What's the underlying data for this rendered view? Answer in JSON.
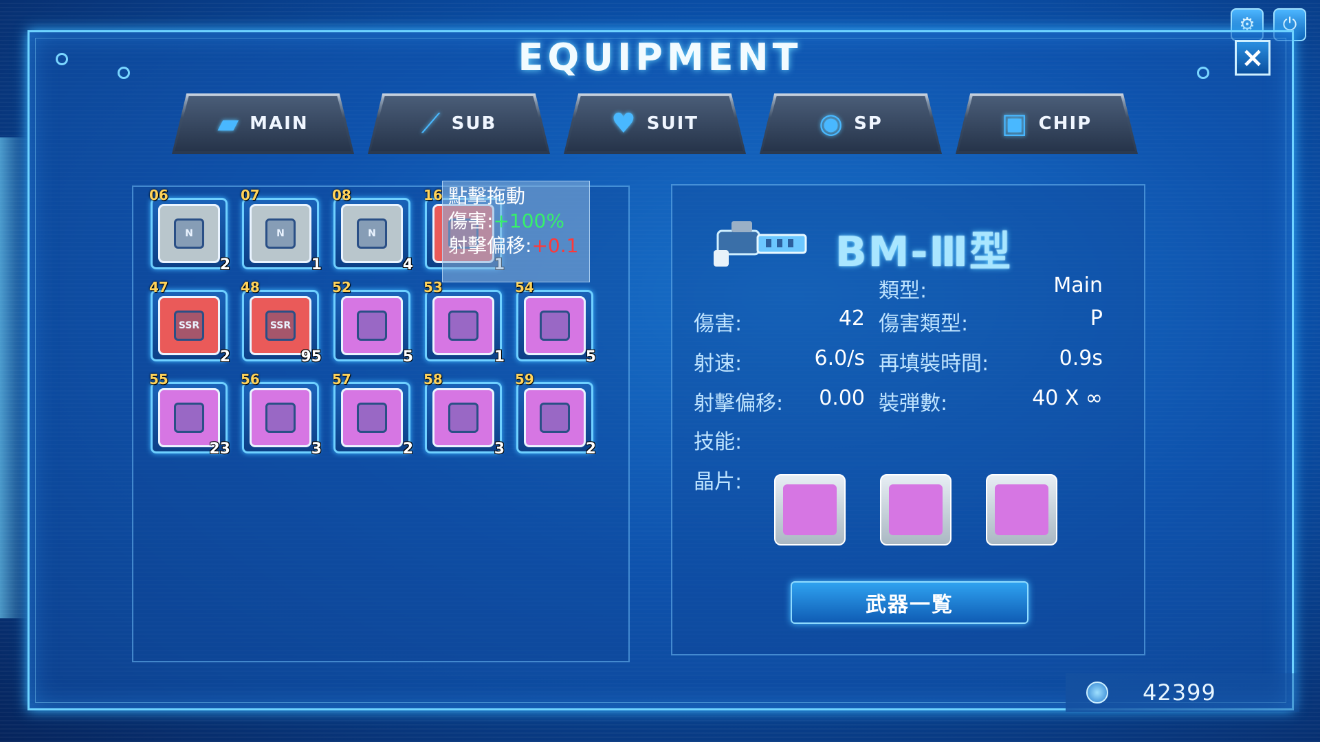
{
  "title": "EQUIPMENT",
  "close_icon": "×",
  "top_icons": [
    {
      "name": "settings-icon",
      "glyph": "⚙"
    },
    {
      "name": "power-icon",
      "glyph": "⏻"
    }
  ],
  "tabs": [
    {
      "label": "MAIN",
      "icon": "pistol-icon",
      "glyph": "▰"
    },
    {
      "label": "SUB",
      "icon": "knife-icon",
      "glyph": "⟋"
    },
    {
      "label": "SUIT",
      "icon": "suit-icon",
      "glyph": "♥"
    },
    {
      "label": "SP",
      "icon": "robot-icon",
      "glyph": "◉"
    },
    {
      "label": "CHIP",
      "icon": "chip-icon",
      "glyph": "▣"
    }
  ],
  "inventory": [
    {
      "id": "06",
      "count": "2",
      "color": "gray",
      "core": "N"
    },
    {
      "id": "07",
      "count": "1",
      "color": "gray",
      "core": "N"
    },
    {
      "id": "08",
      "count": "4",
      "color": "gray",
      "core": "N"
    },
    {
      "id": "16",
      "count": "1",
      "color": "red",
      "core": ""
    },
    {
      "id": "",
      "count": "",
      "color": "",
      "core": ""
    },
    {
      "id": "47",
      "count": "2",
      "color": "red",
      "core": "SSR"
    },
    {
      "id": "48",
      "count": "95",
      "color": "red",
      "core": "SSR"
    },
    {
      "id": "52",
      "count": "5",
      "color": "purple",
      "core": ""
    },
    {
      "id": "53",
      "count": "1",
      "color": "purple",
      "core": ""
    },
    {
      "id": "54",
      "count": "5",
      "color": "purple",
      "core": ""
    },
    {
      "id": "55",
      "count": "23",
      "color": "purple",
      "core": ""
    },
    {
      "id": "56",
      "count": "3",
      "color": "purple",
      "core": ""
    },
    {
      "id": "57",
      "count": "2",
      "color": "purple",
      "core": ""
    },
    {
      "id": "58",
      "count": "3",
      "color": "purple",
      "core": ""
    },
    {
      "id": "59",
      "count": "2",
      "color": "purple",
      "core": ""
    }
  ],
  "tooltip": {
    "line1": "點擊拖動",
    "damage_label": "傷害:",
    "damage_value": "+100%",
    "offset_label": "射擊偏移:",
    "offset_value": "+0.1"
  },
  "weapon": {
    "name": "BM-Ⅲ型",
    "type_label": "類型:",
    "type_value": "Main",
    "damage_label": "傷害:",
    "damage_value": "42",
    "damage_type_label": "傷害類型:",
    "damage_type_value": "P",
    "rate_label": "射速:",
    "rate_value": "6.0/s",
    "reload_label": "再填裝時間:",
    "reload_value": "0.9s",
    "offset_label": "射擊偏移:",
    "offset_value": "0.00",
    "ammo_label": "裝弾數:",
    "ammo_value": "40 X ∞",
    "skill_label": "技能:",
    "chips_label": "晶片:"
  },
  "weapon_list_button": "武器一覧",
  "currency": "42399",
  "colors": {
    "accent": "#6fd3ff",
    "chip_gray": "#b9c6cc",
    "chip_red": "#ea5a59",
    "chip_purple": "#d676e3",
    "slot_id": "#ffd35a"
  }
}
